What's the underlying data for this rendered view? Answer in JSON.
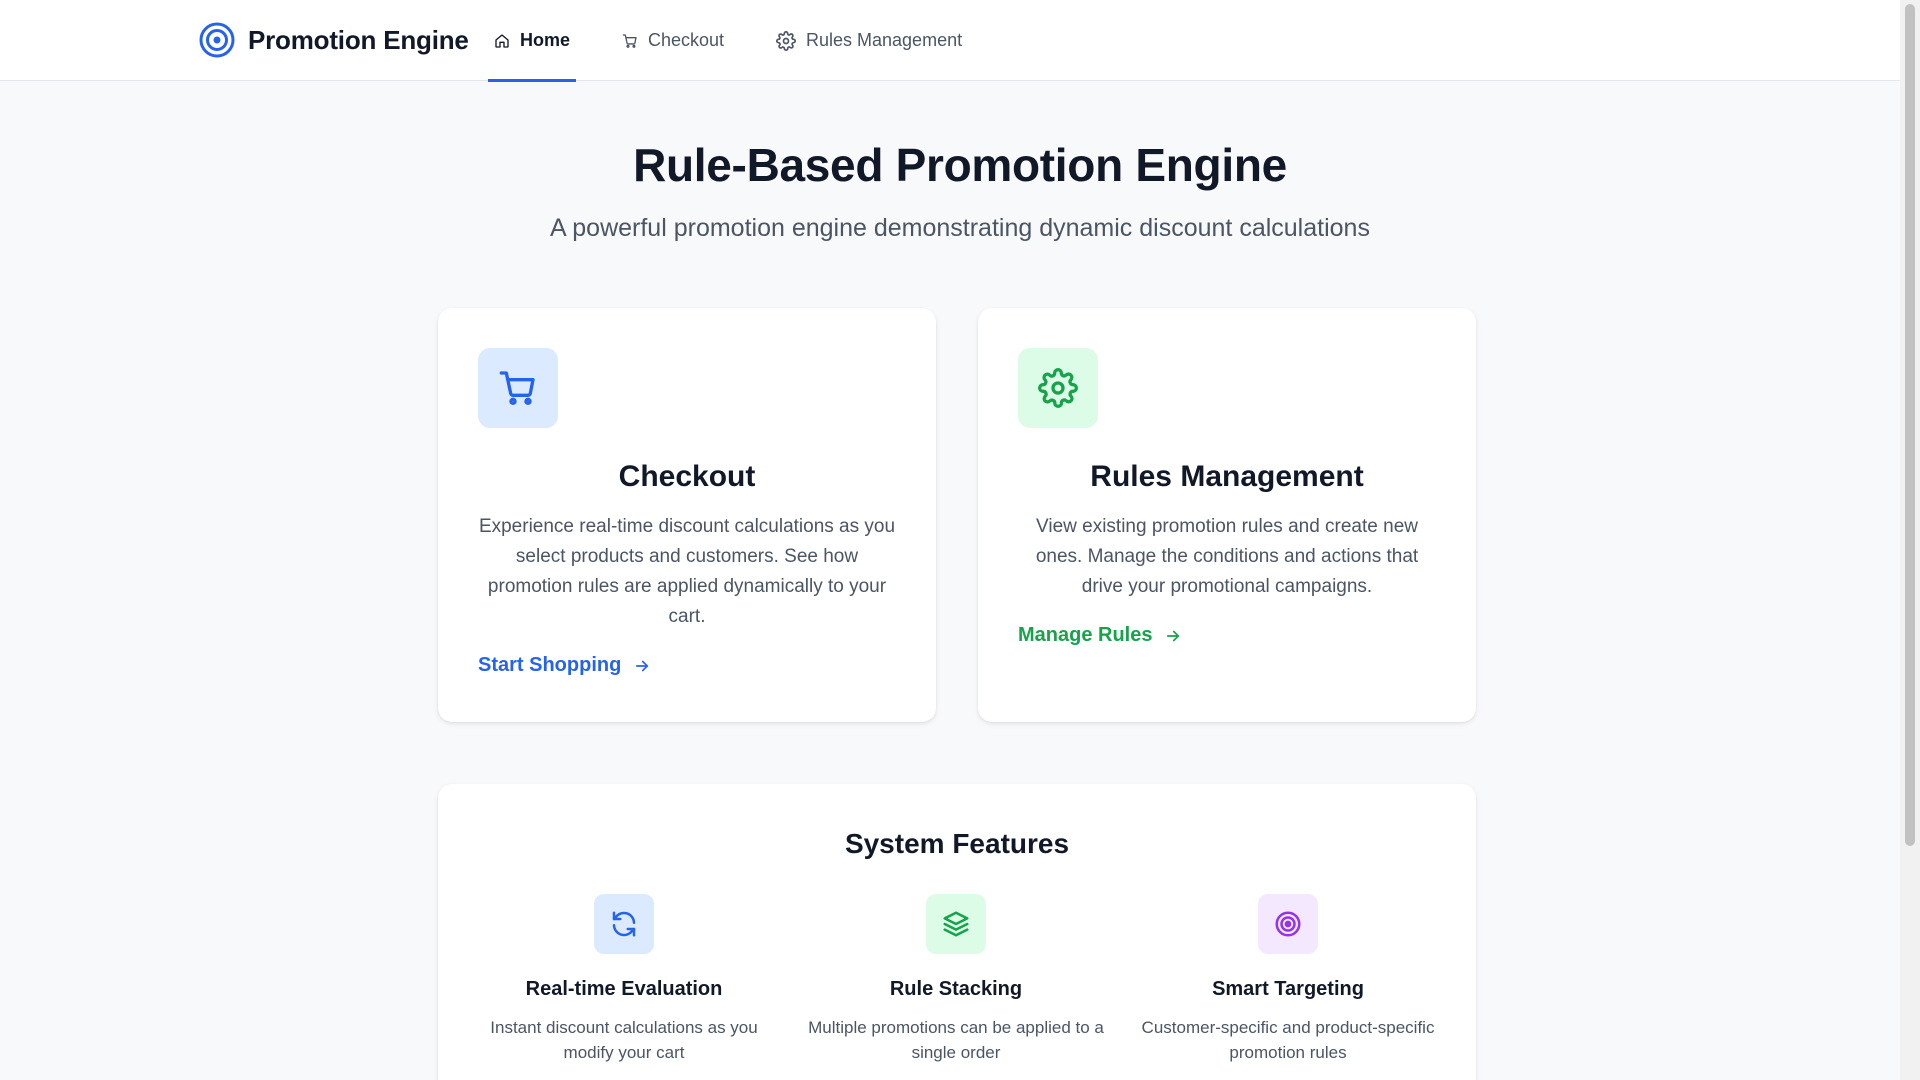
{
  "header": {
    "brand": "Promotion Engine",
    "nav": [
      {
        "label": "Home",
        "icon": "home-icon",
        "active": true
      },
      {
        "label": "Checkout",
        "icon": "cart-icon",
        "active": false
      },
      {
        "label": "Rules Management",
        "icon": "gear-icon",
        "active": false
      }
    ]
  },
  "hero": {
    "title": "Rule-Based Promotion Engine",
    "subtitle": "A powerful promotion engine demonstrating dynamic discount calculations"
  },
  "cards": [
    {
      "icon": "cart-icon",
      "title": "Checkout",
      "description": "Experience real-time discount calculations as you select products and customers. See how promotion rules are applied dynamically to your cart.",
      "link": "Start Shopping"
    },
    {
      "icon": "gear-icon",
      "title": "Rules Management",
      "description": "View existing promotion rules and create new ones. Manage the conditions and actions that drive your promotional campaigns.",
      "link": "Manage Rules"
    }
  ],
  "features": {
    "title": "System Features",
    "items": [
      {
        "icon": "refresh-icon",
        "title": "Real-time Evaluation",
        "description": "Instant discount calculations as you modify your cart"
      },
      {
        "icon": "layers-icon",
        "title": "Rule Stacking",
        "description": "Multiple promotions can be applied to a single order"
      },
      {
        "icon": "target-icon",
        "title": "Smart Targeting",
        "description": "Customer-specific and product-specific promotion rules"
      }
    ]
  },
  "colors": {
    "primary": "#2563eb",
    "success": "#16a34a",
    "purple": "#9333ea",
    "background": "#f8f9fb",
    "text": "#111827",
    "muted": "#4b5563"
  }
}
